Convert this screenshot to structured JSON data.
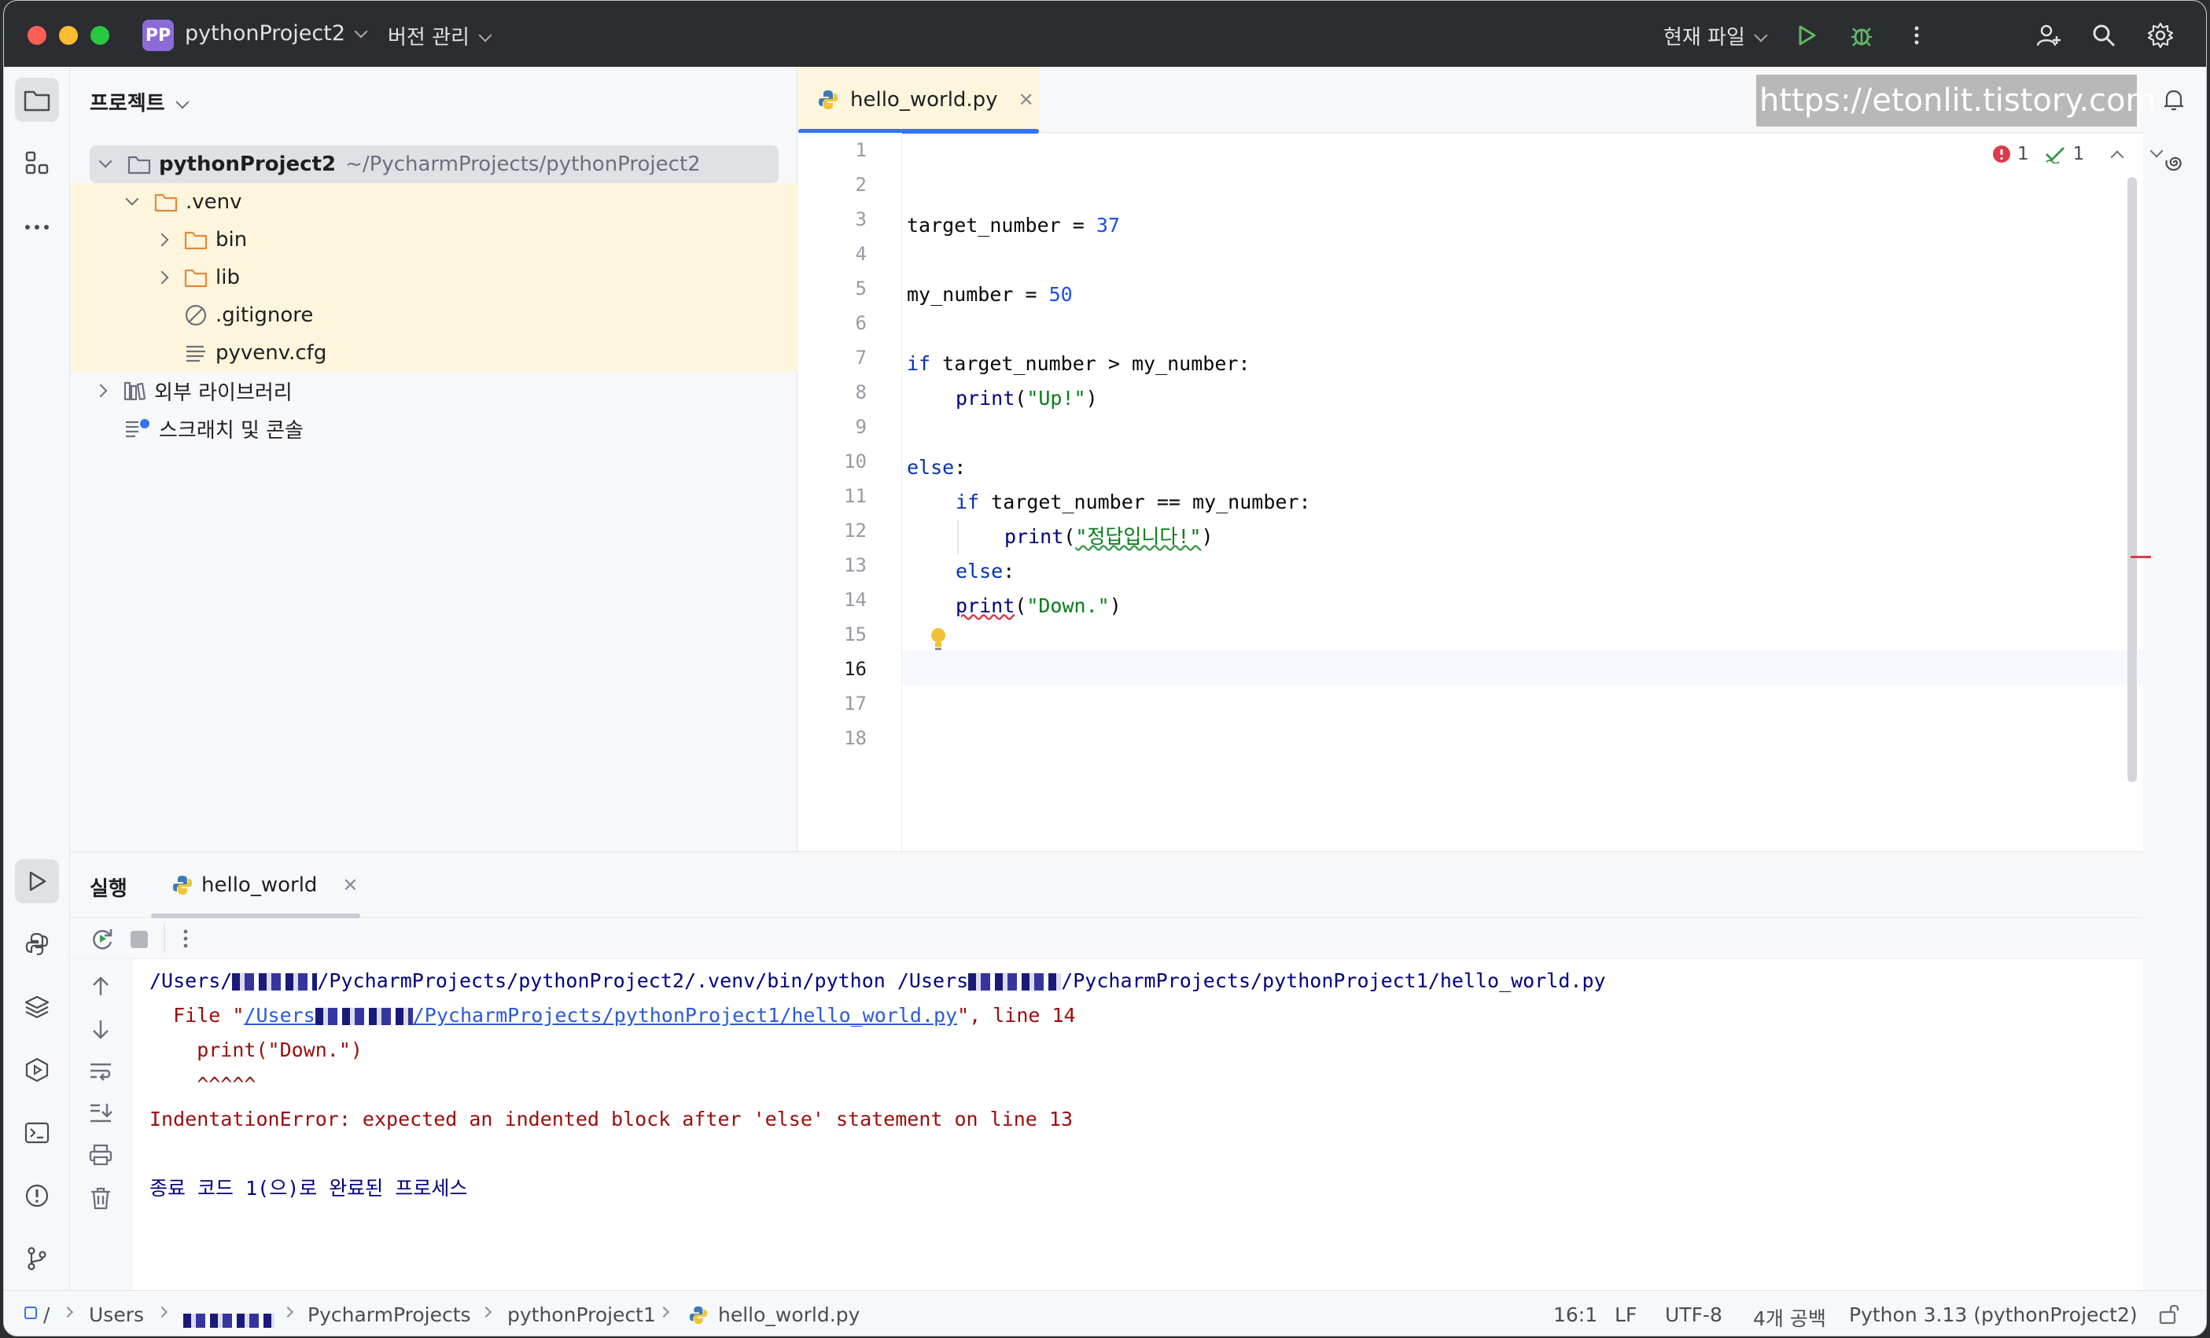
{
  "titlebar": {
    "project_badge": "PP",
    "project_name": "pythonProject2",
    "vcs_label": "버전 관리",
    "run_config": "현재 파일"
  },
  "project_panel": {
    "title": "프로젝트",
    "tree": [
      {
        "label": "pythonProject2",
        "path": "~/PycharmProjects/pythonProject2",
        "icon": "folder-icon"
      },
      {
        "label": ".venv",
        "icon": "folder-icon"
      },
      {
        "label": "bin",
        "icon": "folder-icon"
      },
      {
        "label": "lib",
        "icon": "folder-icon"
      },
      {
        "label": ".gitignore",
        "icon": "ignored-file-icon"
      },
      {
        "label": "pyvenv.cfg",
        "icon": "text-file-icon"
      },
      {
        "label": "외부 라이브러리",
        "icon": "library-icon"
      },
      {
        "label": "스크래치 및 콘솔",
        "icon": "scratch-icon"
      }
    ]
  },
  "editor": {
    "tab_label": "hello_world.py",
    "watermark": "https://etonlit.tistory.com",
    "error_count": "1",
    "warning_count": "1",
    "line_numbers": [
      "1",
      "2",
      "3",
      "4",
      "5",
      "6",
      "7",
      "8",
      "9",
      "10",
      "11",
      "12",
      "13",
      "14",
      "15",
      "16",
      "17",
      "18"
    ],
    "code": {
      "l3_var": "target_number",
      "l3_op": " = ",
      "l3_num": "37",
      "l5_var": "my_number",
      "l5_op": " = ",
      "l5_num": "50",
      "l7_kw": "if",
      "l7_rest": " target_number > my_number:",
      "l8_fn": "print",
      "l8_open": "(",
      "l8_str": "\"Up!\"",
      "l8_close": ")",
      "l10_kw": "else",
      "l10_rest": ":",
      "l11_kw": "if",
      "l11_rest": " target_number == my_number:",
      "l12_fn": "print",
      "l12_open": "(",
      "l12_str": "\"정답입니다!\"",
      "l12_close": ")",
      "l13_kw": "else",
      "l13_rest": ":",
      "l14_fn": "print",
      "l14_open": "(",
      "l14_str": "\"Down.\"",
      "l14_close": ")"
    }
  },
  "run_panel": {
    "title": "실행",
    "tab_label": "hello_world",
    "console": {
      "line1_a": "/Users/",
      "line1_b": "/PycharmProjects/pythonProject2/.venv/bin/python /Users",
      "line1_c": "/PycharmProjects/pythonProject1/hello_world.py",
      "line2_a": "  File \"",
      "line2_link_a": "/Users",
      "line2_link_b": "/PycharmProjects/pythonProject1/hello_world.py",
      "line2_b": "\", line 14",
      "line3": "    print(\"Down.\")",
      "line4": "    ^^^^^",
      "line5": "IndentationError: expected an indented block after 'else' statement on line 13",
      "line6": "종료 코드 1(으)로 완료된 프로세스"
    }
  },
  "statusbar": {
    "crumb_root": "/",
    "crumb_users": "Users",
    "crumb_projects": "PycharmProjects",
    "crumb_project": "pythonProject1",
    "crumb_file": "hello_world.py",
    "position": "16:1",
    "line_sep": "LF",
    "encoding": "UTF-8",
    "indent": "4개 공백",
    "interpreter": "Python 3.13 (pythonProject2)"
  },
  "colors": {
    "accent": "#3574f0",
    "keyword": "#0033b3",
    "string": "#067d17",
    "number": "#1750eb",
    "error": "#9c0b0b",
    "run_green": "#3d9a50"
  }
}
